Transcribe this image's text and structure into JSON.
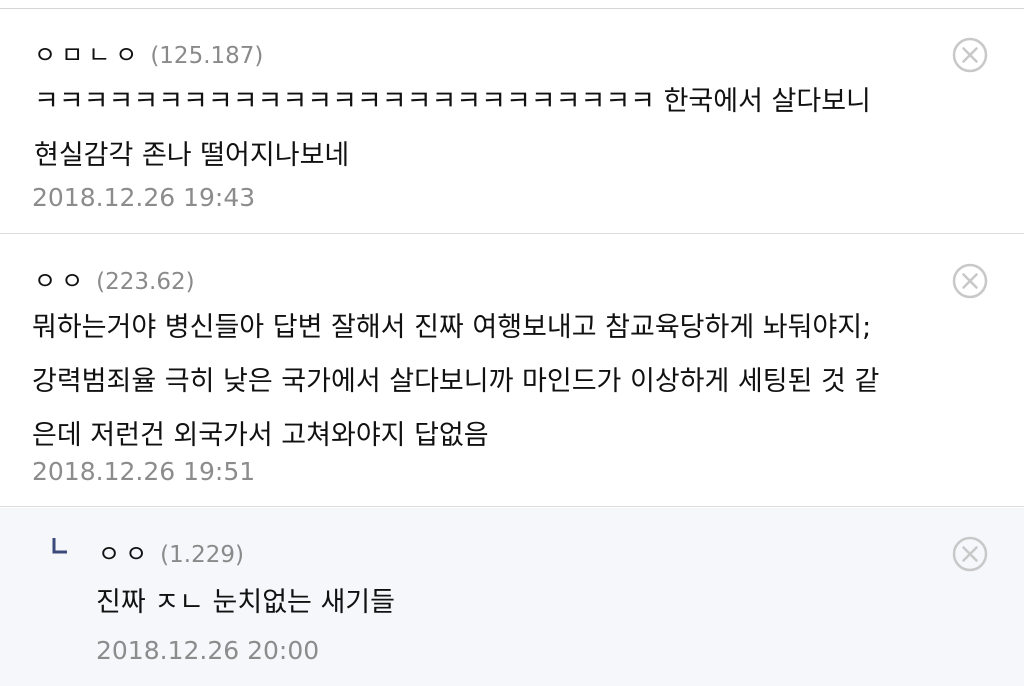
{
  "comments": [
    {
      "nickname": "ㅇㅁㄴㅇ",
      "score": "(125.187)",
      "lines": [
        "ㅋㅋㅋㅋㅋㅋㅋㅋㅋㅋㅋㅋㅋㅋㅋㅋㅋㅋㅋㅋㅋㅋㅋㅋㅋ 한국에서 살다보니",
        "현실감각 존나 떨어지나보네"
      ],
      "timestamp": "2018.12.26 19:43"
    },
    {
      "nickname": "ㅇㅇ",
      "score": "(223.62)",
      "lines": [
        "뭐하는거야 병신들아 답변 잘해서 진짜 여행보내고 참교육당하게 놔둬야지;",
        "강력범죄율 극히 낮은 국가에서 살다보니까 마인드가 이상하게 세팅된 것 같",
        "은데 저런건 외국가서 고쳐와야지 답없음"
      ],
      "timestamp": "2018.12.26 19:51"
    },
    {
      "nickname": "ㅇㅇ",
      "score": "(1.229)",
      "lines": [
        "진짜 ㅈㄴ 눈치없는 새기들"
      ],
      "timestamp": "2018.12.26 20:00",
      "is_reply": true
    }
  ],
  "icons": {
    "delete": "circle-x-icon",
    "reply": "reply-arrow-icon"
  },
  "colors": {
    "reply_background": "#f6f7fa",
    "meta_text": "#8c8c8c",
    "reply_marker": "#3b4a7a"
  }
}
